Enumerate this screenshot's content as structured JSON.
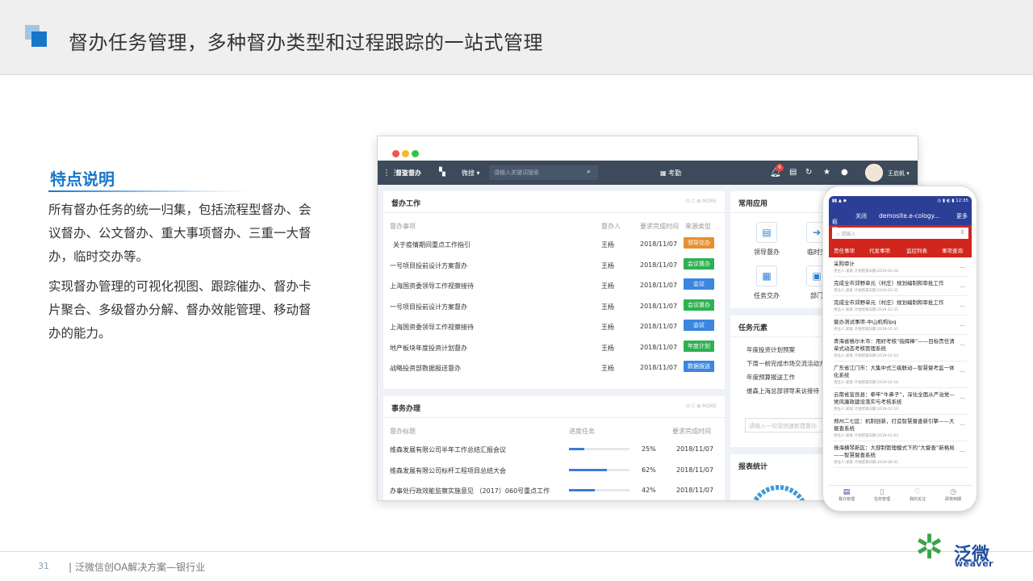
{
  "header": {
    "title": "督办任务管理，多种督办类型和过程跟踪的一站式管理"
  },
  "features": {
    "heading": "特点说明",
    "para1": "所有督办任务的统一归集，包括流程型督办、会议督办、公文督办、重大事项督办、三重一大督办，临时交办等。",
    "para2": "实现督办管理的可视化视图、跟踪催办、督办卡片聚合、多级督办分解、督办效能管理、移动督办的能力。"
  },
  "desktop": {
    "brand": "督查督办",
    "dropdown": "微搜",
    "search_placeholder": "请输入关键词搜索",
    "center_label": "考勤",
    "notification_count": "6",
    "user_name": "王启帆",
    "duban_card": {
      "title": "督办工作",
      "tools": "⊡ C ✿ MORE",
      "headers": [
        "督办事项",
        "督办人",
        "要求完成时间",
        "来源类型"
      ],
      "rows": [
        {
          "item": "关于疫情期间重点工作指引",
          "person": "王杨",
          "date": "2018/11/07",
          "type": "领导交办",
          "color": "#e8902b"
        },
        {
          "item": "一号项目投前设计方案督办",
          "person": "王杨",
          "date": "2018/11/07",
          "type": "会议督办",
          "color": "#2eb152"
        },
        {
          "item": "上海国资委领导工作视察接待",
          "person": "王杨",
          "date": "2018/11/07",
          "type": "会议",
          "color": "#3b86e0"
        },
        {
          "item": "一号项目投前设计方案督办",
          "person": "王杨",
          "date": "2018/11/07",
          "type": "会议督办",
          "color": "#2eb152"
        },
        {
          "item": "上海国资委领导工作视察接待",
          "person": "王杨",
          "date": "2018/11/07",
          "type": "会议",
          "color": "#3b86e0"
        },
        {
          "item": "地产板块年度投资计划督办",
          "person": "王杨",
          "date": "2018/11/07",
          "type": "年度计划",
          "color": "#2eb152"
        },
        {
          "item": "战略投资部数据报送督办",
          "person": "王杨",
          "date": "2018/11/07",
          "type": "数据报送",
          "color": "#3b86e0"
        }
      ]
    },
    "affairs_card": {
      "title": "事务办理",
      "tools": "⊡ C ✿ MORE",
      "headers": [
        "督办标题",
        "进度任务",
        "要求完成时间"
      ],
      "rows": [
        {
          "title": "维森发展有限公司半年工作总结汇报会议",
          "pct": "25%",
          "progress": 0.25,
          "date": "2018/11/07"
        },
        {
          "title": "维森发展有限公司标杆工程项目总结大会",
          "pct": "62%",
          "progress": 0.62,
          "date": "2018/11/07"
        },
        {
          "title": "办事处行政效能监察实施意见 （2017）060号重点工作",
          "pct": "42%",
          "progress": 0.42,
          "date": "2018/11/07"
        }
      ]
    },
    "apps_card": {
      "title": "常用应用",
      "apps": [
        {
          "label": "领导督办",
          "icon": "▤"
        },
        {
          "label": "临时交",
          "icon": "➔"
        },
        {
          "label": "任务交办",
          "icon": "▦"
        },
        {
          "label": "部门",
          "icon": "▣"
        }
      ]
    },
    "elements_card": {
      "title": "任务元素",
      "items": [
        "年度投资计划预案",
        "下周一前完成市场交流活动方案",
        "年度预算报送工作",
        "维森上海总部领导来访接待"
      ],
      "input_placeholder": "请输入一句话快速新建督办"
    },
    "stats_card": {
      "title": "报表统计"
    }
  },
  "phone": {
    "status_left": "▮▮ ▲ ◆",
    "status_right": "◎ ▮ ◐ ▮ 12:35",
    "back": "返回",
    "close": "关闭",
    "nav_title": "demosite.e-cology...",
    "more": "更多",
    "search_placeholder": "请输入",
    "tabs": [
      "责任事项",
      "代发事项",
      "监控列表",
      "事项查询"
    ],
    "items": [
      {
        "title": "采购审计",
        "sub": "责任人:某某   计划结束日期:2019-02-28"
      },
      {
        "title": "完成全市郊野单元（村庄）规划编制和审批工作",
        "sub": "责任人:某某   计划结束日期:2019-01-31"
      },
      {
        "title": "完成全市郊野单元（村庄）规划编制和审批工作",
        "sub": "责任人:某某   计划结束日期:2019-12-31"
      },
      {
        "title": "督办测试事项-中山机构lpq",
        "sub": "责任人:某某   计划结束日期:2019-05-31"
      },
      {
        "title": "青海省格尔木市：用好考核“指挥棒”——目标责任清单式动态考核管理系统",
        "sub": "责任人:某某   计划结束日期:2019-02-24"
      },
      {
        "title": "广东省江门市：大集中式三级联动—智慧督考监一体化系统",
        "sub": "责任人:某某   计划结束日期:2019-03-16"
      },
      {
        "title": "云南省宣良县：牵牢“牛鼻子”，深化全面从严治党—党风廉政建设落实与考核系统",
        "sub": "责任人:某某   计划结束日期:2019-01-10"
      },
      {
        "title": "郑州二七区：机制创新，打造智慧督查新引擎——大督查系统",
        "sub": "责任人:某某   计划结束日期:2019-01-03"
      },
      {
        "title": "珠海横琴新区：大部制管理模式下的“大督查”新格局——智慧督查系统",
        "sub": "责任人:某某   计划结束日期:2019-06-01"
      }
    ],
    "bottom": [
      {
        "label": "督办管理",
        "icon": "▤"
      },
      {
        "label": "任务管理",
        "icon": "▯"
      },
      {
        "label": "我的关注",
        "icon": "♡"
      },
      {
        "label": "即将到期",
        "icon": "◷"
      }
    ]
  },
  "footer": {
    "page_number": "31",
    "text": "| 泛微信创OA解决方案—银行业",
    "logo_cn": "泛微",
    "logo_en": "weaver"
  },
  "colors": {
    "accent": "#1677c9",
    "nav_dark": "#3c4a5b",
    "phone_blue": "#2b3f97",
    "phone_red": "#d0261d",
    "logo_green": "#3aa34b"
  }
}
